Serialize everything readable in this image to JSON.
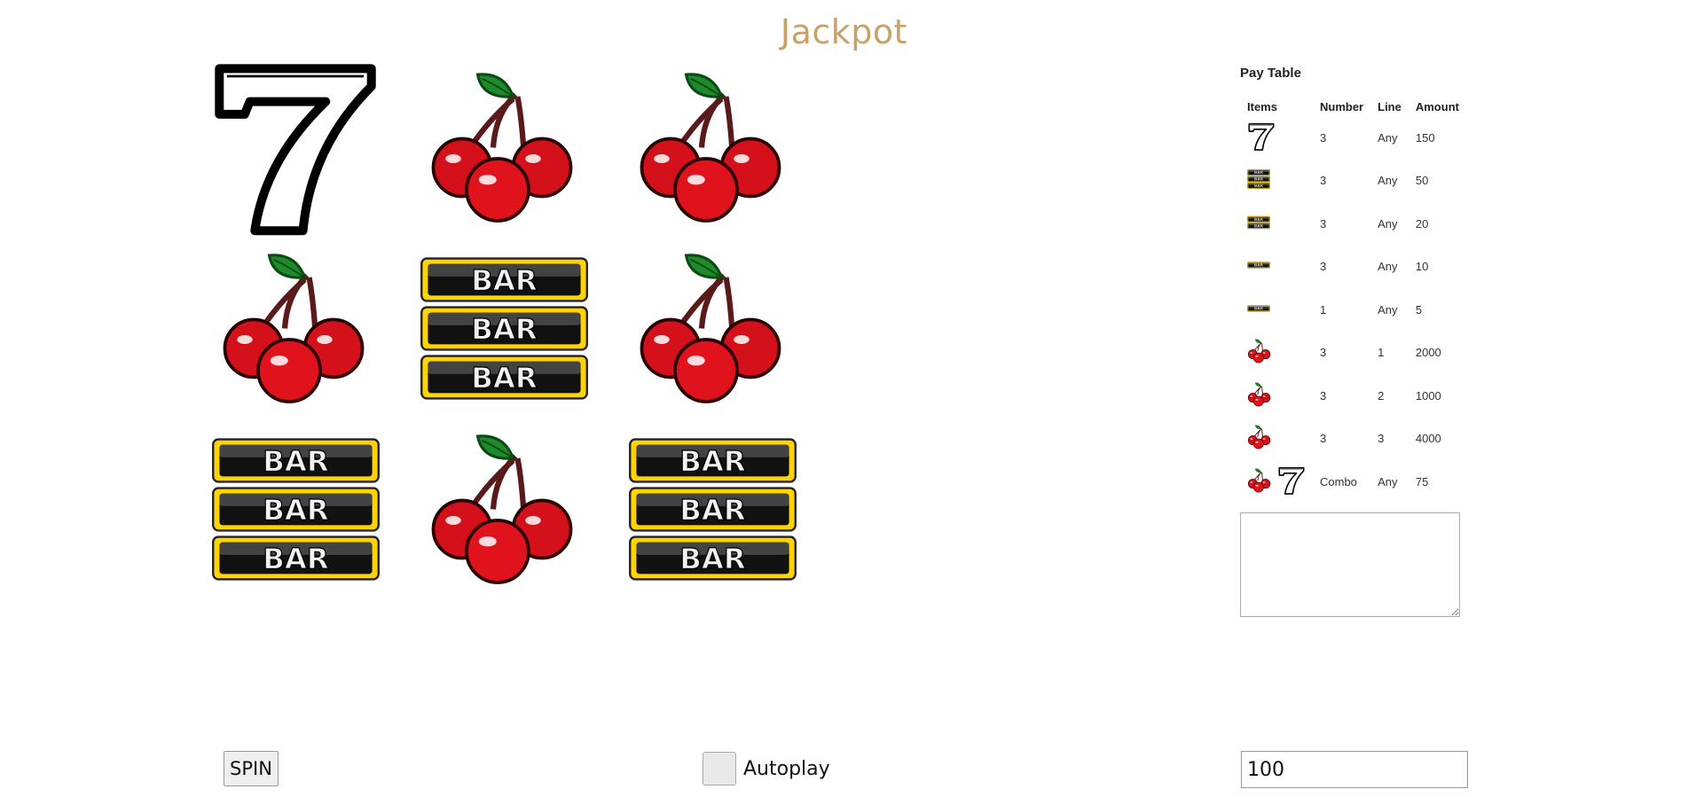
{
  "app": {
    "title": "Jackpot"
  },
  "reels": [
    [
      "seven",
      "cherry",
      "cherry"
    ],
    [
      "cherry",
      "triple-bar",
      "cherry"
    ],
    [
      "triple-bar",
      "cherry",
      "triple-bar"
    ]
  ],
  "paytable": {
    "title": "Pay Table",
    "headers": [
      "Items",
      "Number",
      "Line",
      "Amount"
    ],
    "rows": [
      {
        "icons": [
          "seven"
        ],
        "number": "3",
        "line": "Any",
        "amount": "150"
      },
      {
        "icons": [
          "triple-bar"
        ],
        "number": "3",
        "line": "Any",
        "amount": "50"
      },
      {
        "icons": [
          "double-bar"
        ],
        "number": "3",
        "line": "Any",
        "amount": "20"
      },
      {
        "icons": [
          "single-bar"
        ],
        "number": "3",
        "line": "Any",
        "amount": "10"
      },
      {
        "icons": [
          "single-bar"
        ],
        "number": "1",
        "line": "Any",
        "amount": "5"
      },
      {
        "icons": [
          "cherry"
        ],
        "number": "3",
        "line": "1",
        "amount": "2000"
      },
      {
        "icons": [
          "cherry"
        ],
        "number": "3",
        "line": "2",
        "amount": "1000"
      },
      {
        "icons": [
          "cherry"
        ],
        "number": "3",
        "line": "3",
        "amount": "4000"
      },
      {
        "icons": [
          "cherry",
          "seven"
        ],
        "number": "Combo",
        "line": "Any",
        "amount": "75"
      }
    ]
  },
  "log": {
    "value": ""
  },
  "controls": {
    "spin_label": "SPIN",
    "autoplay_label": "Autoplay",
    "bet_value": "100"
  }
}
